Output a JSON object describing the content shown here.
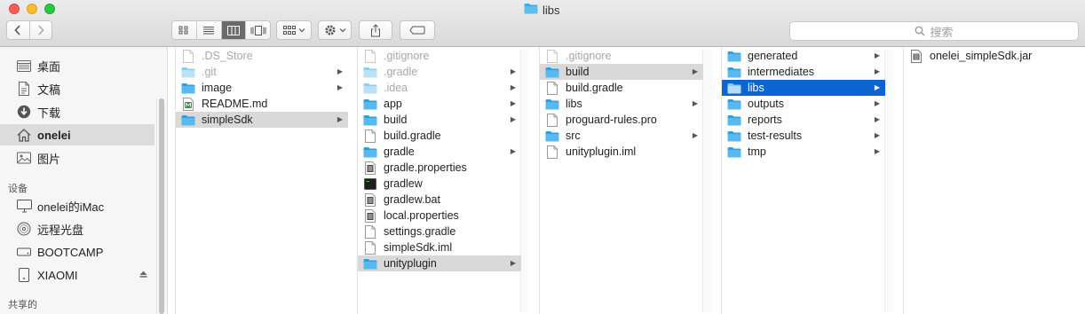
{
  "window": {
    "title": "libs"
  },
  "toolbar": {
    "search_placeholder": "搜索",
    "view_modes": [
      "icon-view",
      "list-view",
      "column-view",
      "coverflow-view"
    ],
    "active_view": "column-view"
  },
  "sidebar": {
    "favorites": [
      {
        "label": "桌面",
        "icon": "desktop-icon"
      },
      {
        "label": "文稿",
        "icon": "documents-icon"
      },
      {
        "label": "下载",
        "icon": "downloads-icon"
      },
      {
        "label": "onelei",
        "icon": "home-icon",
        "selected": true
      },
      {
        "label": "图片",
        "icon": "pictures-icon"
      }
    ],
    "devices_header": "设备",
    "devices": [
      {
        "label": "onelei的iMac",
        "icon": "imac-icon"
      },
      {
        "label": "远程光盘",
        "icon": "remote-disc-icon"
      },
      {
        "label": "BOOTCAMP",
        "icon": "drive-icon"
      },
      {
        "label": "XIAOMI",
        "icon": "drive-icon",
        "eject": true
      }
    ],
    "shared_header": "共享的"
  },
  "columns": [
    {
      "items": [
        {
          "name": ".DS_Store",
          "type": "file",
          "dim": true
        },
        {
          "name": ".git",
          "type": "folder",
          "dim": true,
          "arrow": true
        },
        {
          "name": "image",
          "type": "folder",
          "arrow": true
        },
        {
          "name": "README.md",
          "type": "md"
        },
        {
          "name": "simpleSdk",
          "type": "folder",
          "arrow": true,
          "state": "path"
        }
      ]
    },
    {
      "items": [
        {
          "name": ".gitignore",
          "type": "file",
          "dim": true
        },
        {
          "name": ".gradle",
          "type": "folder",
          "dim": true,
          "arrow": true
        },
        {
          "name": ".idea",
          "type": "folder",
          "dim": true,
          "arrow": true
        },
        {
          "name": "app",
          "type": "folder",
          "arrow": true
        },
        {
          "name": "build",
          "type": "folder",
          "arrow": true
        },
        {
          "name": "build.gradle",
          "type": "file"
        },
        {
          "name": "gradle",
          "type": "folder",
          "arrow": true
        },
        {
          "name": "gradle.properties",
          "type": "props"
        },
        {
          "name": "gradlew",
          "type": "exec"
        },
        {
          "name": "gradlew.bat",
          "type": "props"
        },
        {
          "name": "local.properties",
          "type": "props"
        },
        {
          "name": "settings.gradle",
          "type": "file"
        },
        {
          "name": "simpleSdk.iml",
          "type": "file"
        },
        {
          "name": "unityplugin",
          "type": "folder",
          "arrow": true,
          "state": "path"
        }
      ]
    },
    {
      "items": [
        {
          "name": ".gitignore",
          "type": "file",
          "dim": true
        },
        {
          "name": "build",
          "type": "folder",
          "arrow": true,
          "state": "path"
        },
        {
          "name": "build.gradle",
          "type": "file"
        },
        {
          "name": "libs",
          "type": "folder",
          "arrow": true
        },
        {
          "name": "proguard-rules.pro",
          "type": "file"
        },
        {
          "name": "src",
          "type": "folder",
          "arrow": true
        },
        {
          "name": "unityplugin.iml",
          "type": "file"
        }
      ]
    },
    {
      "items": [
        {
          "name": "generated",
          "type": "folder",
          "arrow": true
        },
        {
          "name": "intermediates",
          "type": "folder",
          "arrow": true
        },
        {
          "name": "libs",
          "type": "folder",
          "arrow": true,
          "state": "active"
        },
        {
          "name": "outputs",
          "type": "folder",
          "arrow": true
        },
        {
          "name": "reports",
          "type": "folder",
          "arrow": true
        },
        {
          "name": "test-results",
          "type": "folder",
          "arrow": true
        },
        {
          "name": "tmp",
          "type": "folder",
          "arrow": true
        }
      ]
    },
    {
      "items": [
        {
          "name": "onelei_simpleSdk.jar",
          "type": "jar"
        }
      ]
    }
  ],
  "colors": {
    "accent": "#0b64d0",
    "folder": "#3dabe8",
    "folder_dim": "#a9d8f3",
    "path_highlight": "#d9d9d9"
  }
}
